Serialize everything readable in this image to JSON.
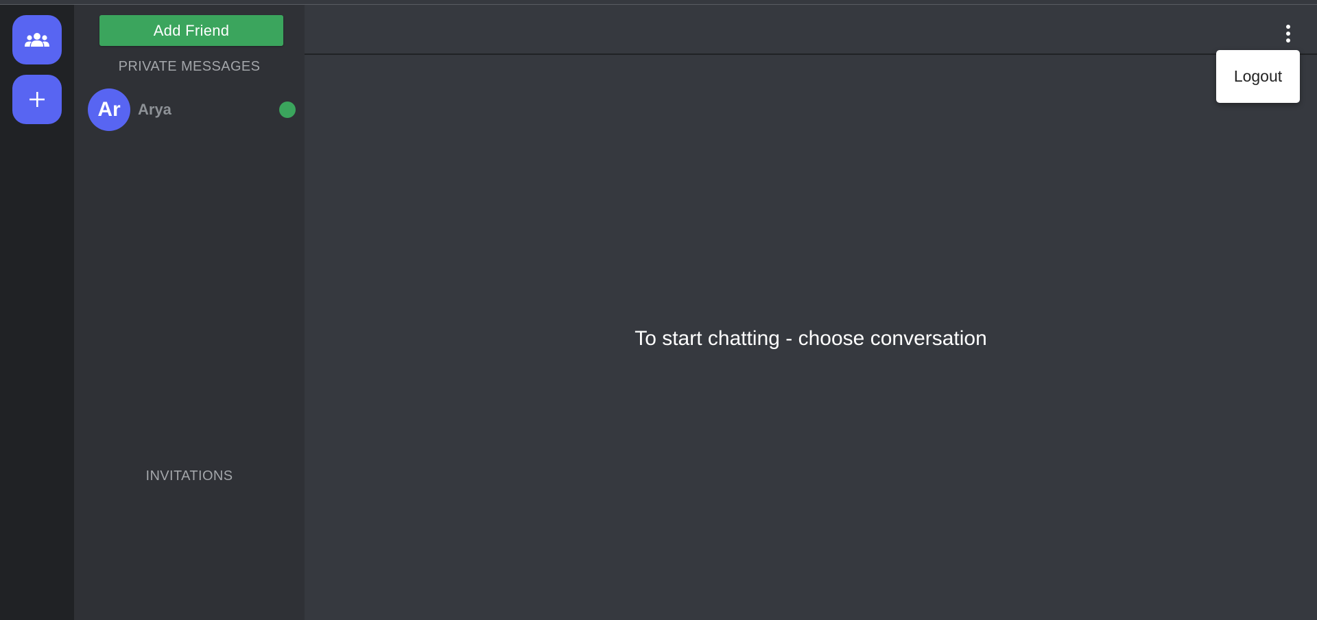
{
  "rail": {
    "groups_icon": "groups-icon",
    "add_icon": "plus-icon"
  },
  "sidebar": {
    "add_friend_label": "Add Friend",
    "private_messages_label": "PRIVATE MESSAGES",
    "friends": [
      {
        "initials": "Ar",
        "name": "Arya",
        "status": "online"
      }
    ],
    "invitations_label": "INVITATIONS"
  },
  "main": {
    "empty_message": "To start chatting - choose conversation"
  },
  "menu": {
    "logout_label": "Logout"
  },
  "colors": {
    "accent": "#5865f2",
    "online": "#3ba55d",
    "rail_bg": "#202225",
    "sidebar_bg": "#2f3136",
    "main_bg": "#36393f"
  }
}
